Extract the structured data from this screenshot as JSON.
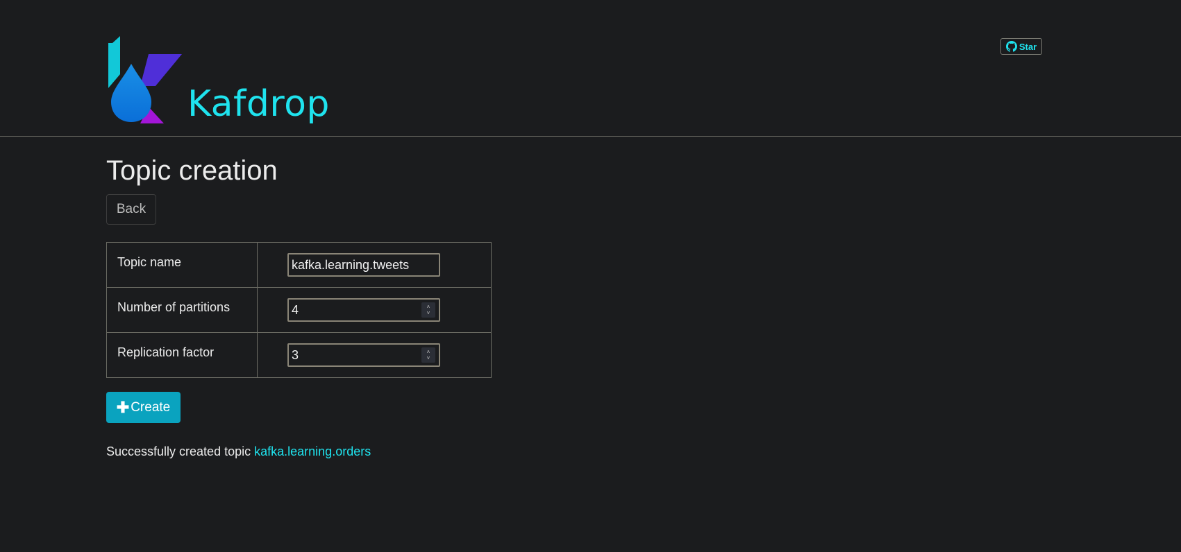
{
  "header": {
    "brand": "Kafdrop",
    "star_label": "Star"
  },
  "page": {
    "title": "Topic creation",
    "back_label": "Back"
  },
  "form": {
    "topic_name": {
      "label": "Topic name",
      "value": "kafka.learning.tweets"
    },
    "partitions": {
      "label": "Number of partitions",
      "value": "4"
    },
    "replication": {
      "label": "Replication factor",
      "value": "3"
    }
  },
  "actions": {
    "create_label": "Create"
  },
  "status": {
    "message": "Successfully created topic",
    "topic_link": "kafka.learning.orders"
  },
  "colors": {
    "accent": "#1fe3ee",
    "button": "#0aa3bf",
    "background": "#1b1c1e"
  }
}
